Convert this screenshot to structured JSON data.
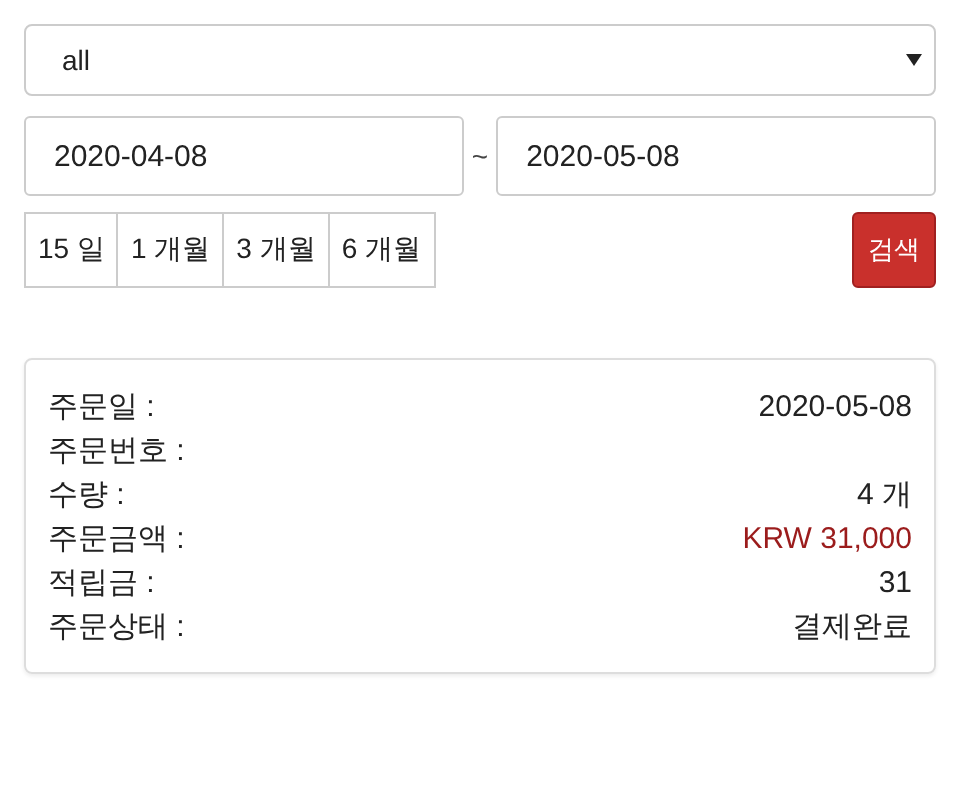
{
  "filter": {
    "value": "all"
  },
  "dates": {
    "from": "2020-04-08",
    "separator": "~",
    "to": "2020-05-08"
  },
  "periods": [
    {
      "label": "15 일",
      "selected": false
    },
    {
      "label": "1 개월",
      "selected": false
    },
    {
      "label": "3 개월",
      "selected": false
    },
    {
      "label": "6 개월",
      "selected": false
    }
  ],
  "search_button": "검색",
  "order": [
    {
      "label": "주문일 :",
      "value": "2020-05-08",
      "kind": "plain"
    },
    {
      "label": "주문번호 :",
      "kind": "plain"
    },
    {
      "label": "수량 :",
      "value": "4 개",
      "kind": "plain"
    },
    {
      "label": "주문금액 :",
      "value": "KRW 31,000",
      "kind": "price"
    },
    {
      "label": "적립금 :",
      "value": "31",
      "kind": "plain"
    },
    {
      "label": "주문상태 :",
      "value": "결제완료",
      "kind": "plain"
    }
  ]
}
